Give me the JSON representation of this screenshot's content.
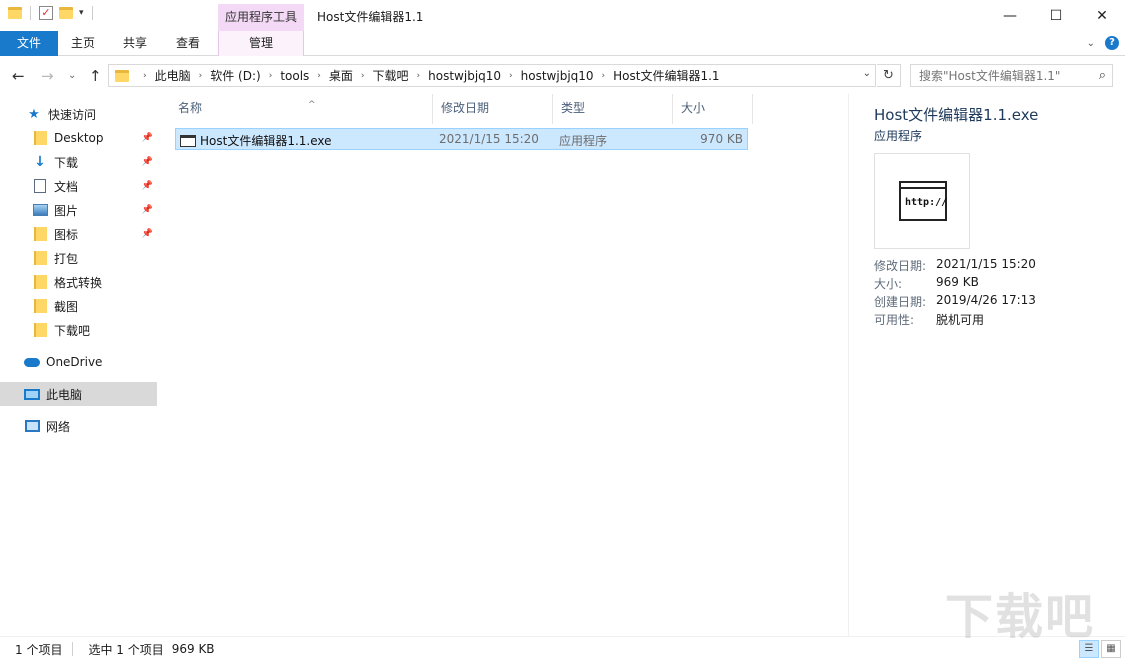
{
  "window": {
    "title": "Host文件编辑器1.1",
    "context_tab_group": "应用程序工具"
  },
  "ribbon": {
    "tabs": [
      "文件",
      "主页",
      "共享",
      "查看",
      "管理"
    ]
  },
  "nav": {
    "breadcrumbs": [
      "此电脑",
      "软件 (D:)",
      "tools",
      "桌面",
      "下载吧",
      "hostwjbjq10",
      "hostwjbjq10",
      "Host文件编辑器1.1"
    ],
    "search_placeholder": "搜索\"Host文件编辑器1.1\""
  },
  "sidebar": {
    "quick_access": "快速访问",
    "items": [
      {
        "label": "Desktop",
        "icon": "folder-icon",
        "pinned": true
      },
      {
        "label": "下载",
        "icon": "download-icon",
        "pinned": true
      },
      {
        "label": "文档",
        "icon": "document-icon",
        "pinned": true
      },
      {
        "label": "图片",
        "icon": "pictures-icon",
        "pinned": true
      },
      {
        "label": "图标",
        "icon": "folder-icon",
        "pinned": true
      },
      {
        "label": "打包",
        "icon": "folder-icon",
        "pinned": false
      },
      {
        "label": "格式转换",
        "icon": "folder-icon",
        "pinned": false
      },
      {
        "label": "截图",
        "icon": "folder-icon",
        "pinned": false
      },
      {
        "label": "下载吧",
        "icon": "folder-icon",
        "pinned": false
      }
    ],
    "onedrive": "OneDrive",
    "this_pc": "此电脑",
    "network": "网络"
  },
  "filelist": {
    "headers": {
      "name": "名称",
      "date": "修改日期",
      "type": "类型",
      "size": "大小"
    },
    "rows": [
      {
        "name": "Host文件编辑器1.1.exe",
        "date": "2021/1/15 15:20",
        "type": "应用程序",
        "size": "970 KB",
        "selected": true
      }
    ]
  },
  "preview": {
    "title": "Host文件编辑器1.1.exe",
    "type": "应用程序",
    "thumb_text": "http://",
    "props": [
      {
        "key": "修改日期:",
        "value": "2021/1/15 15:20"
      },
      {
        "key": "大小:",
        "value": "969 KB"
      },
      {
        "key": "创建日期:",
        "value": "2019/4/26 17:13"
      },
      {
        "key": "可用性:",
        "value": "脱机可用"
      }
    ]
  },
  "status": {
    "count": "1 个项目",
    "selected": "选中 1 个项目",
    "size": "969 KB"
  },
  "watermark": "下载吧",
  "colors": {
    "accent": "#1979ca",
    "selection": "#cce8ff",
    "context_tab": "#f3d9f5"
  }
}
